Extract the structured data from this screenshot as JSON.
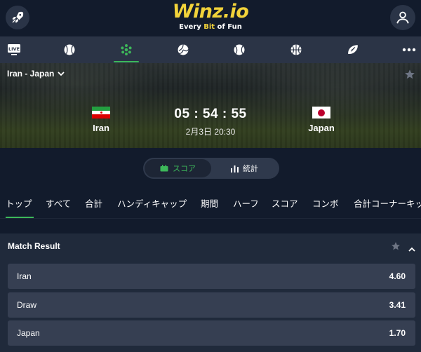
{
  "header": {
    "logo_main": "Winz.io",
    "logo_tag_pre": "Every ",
    "logo_tag_bit": "Bit",
    "logo_tag_post": " of Fun",
    "menu_icon": "rocket-icon",
    "account_icon": "user-icon"
  },
  "sports_nav": {
    "items": [
      {
        "icon": "live-icon",
        "label": "LIVE"
      },
      {
        "icon": "baseball-icon"
      },
      {
        "icon": "soccer-icon",
        "active": true
      },
      {
        "icon": "volleyball-icon"
      },
      {
        "icon": "tennis-icon"
      },
      {
        "icon": "basketball-icon"
      },
      {
        "icon": "rugby-icon"
      },
      {
        "icon": "more-icon"
      }
    ]
  },
  "match": {
    "selector_label": "Iran - Japan",
    "home": {
      "name": "Iran",
      "flag": "iran-flag-icon"
    },
    "away": {
      "name": "Japan",
      "flag": "japan-flag-icon"
    },
    "countdown": "05 : 54 : 55",
    "kickoff": "2月3日 20:30"
  },
  "view_toggle": {
    "score_label": "スコア",
    "stats_label": "統計",
    "active": "score"
  },
  "market_tabs": [
    "トップ",
    "すべて",
    "合計",
    "ハンディキャップ",
    "期間",
    "ハーフ",
    "スコア",
    "コンボ",
    "合計コーナーキック"
  ],
  "market": {
    "title": "Match Result",
    "outcomes": [
      {
        "name": "Iran",
        "odds": "4.60"
      },
      {
        "name": "Draw",
        "odds": "3.41"
      },
      {
        "name": "Japan",
        "odds": "1.70"
      }
    ]
  },
  "colors": {
    "background": "#121b2c",
    "accent_green": "#3db85a",
    "logo_yellow": "#f2d33a",
    "panel": "#202a3b",
    "outcome_bg": "#363f52"
  }
}
